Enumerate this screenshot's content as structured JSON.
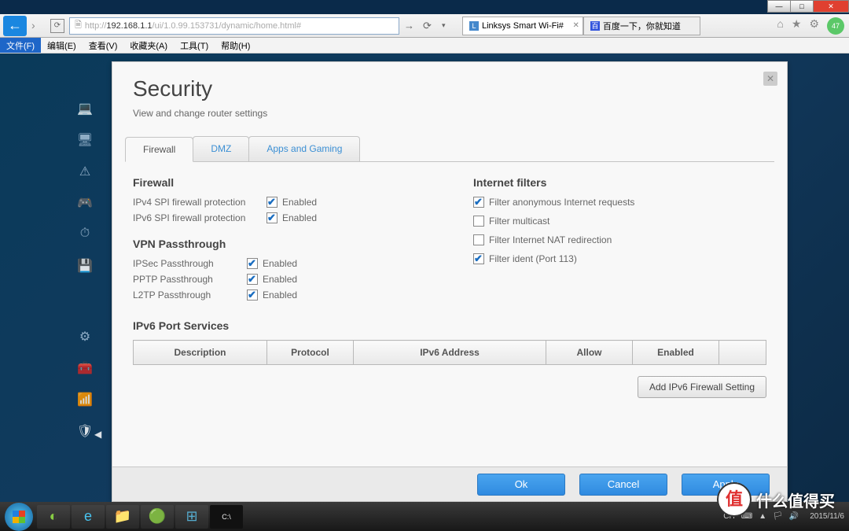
{
  "window": {
    "minimize": "—",
    "maximize": "□",
    "close": "✕"
  },
  "browser": {
    "url_proto": "http://",
    "url_host": "192.168.1.1",
    "url_path": "/ui/1.0.99.153731/dynamic/home.html#",
    "tabs": [
      {
        "title": "Linksys Smart Wi-Fi#"
      },
      {
        "title": "百度一下，你就知道"
      }
    ],
    "badge": "47"
  },
  "menubar": [
    "文件(F)",
    "编辑(E)",
    "查看(V)",
    "收藏夹(A)",
    "工具(T)",
    "帮助(H)"
  ],
  "panel": {
    "title": "Security",
    "subtitle": "View and change router settings",
    "tabs": [
      "Firewall",
      "DMZ",
      "Apps and Gaming"
    ],
    "firewall_heading": "Firewall",
    "vpn_heading": "VPN Passthrough",
    "filters_heading": "Internet filters",
    "ipv6_heading": "IPv6 Port Services",
    "enabled_label": "Enabled",
    "firewall": [
      {
        "label": "IPv4 SPI firewall protection",
        "checked": true
      },
      {
        "label": "IPv6 SPI firewall protection",
        "checked": true
      }
    ],
    "vpn": [
      {
        "label": "IPSec Passthrough",
        "checked": true
      },
      {
        "label": "PPTP Passthrough",
        "checked": true
      },
      {
        "label": "L2TP Passthrough",
        "checked": true
      }
    ],
    "filters": [
      {
        "label": "Filter anonymous Internet requests",
        "checked": true
      },
      {
        "label": "Filter multicast",
        "checked": false
      },
      {
        "label": "Filter Internet NAT redirection",
        "checked": false
      },
      {
        "label": "Filter ident (Port 113)",
        "checked": true
      }
    ],
    "ipv6_cols": [
      "Description",
      "Protocol",
      "IPv6 Address",
      "Allow",
      "Enabled"
    ],
    "add_btn": "Add IPv6 Firewall Setting",
    "ok": "Ok",
    "cancel": "Cancel",
    "apply": "Apply"
  },
  "tray": {
    "lang": "CH",
    "time": "",
    "date": "2015/11/6"
  },
  "watermark": {
    "char": "值",
    "text": "什么值得买"
  }
}
